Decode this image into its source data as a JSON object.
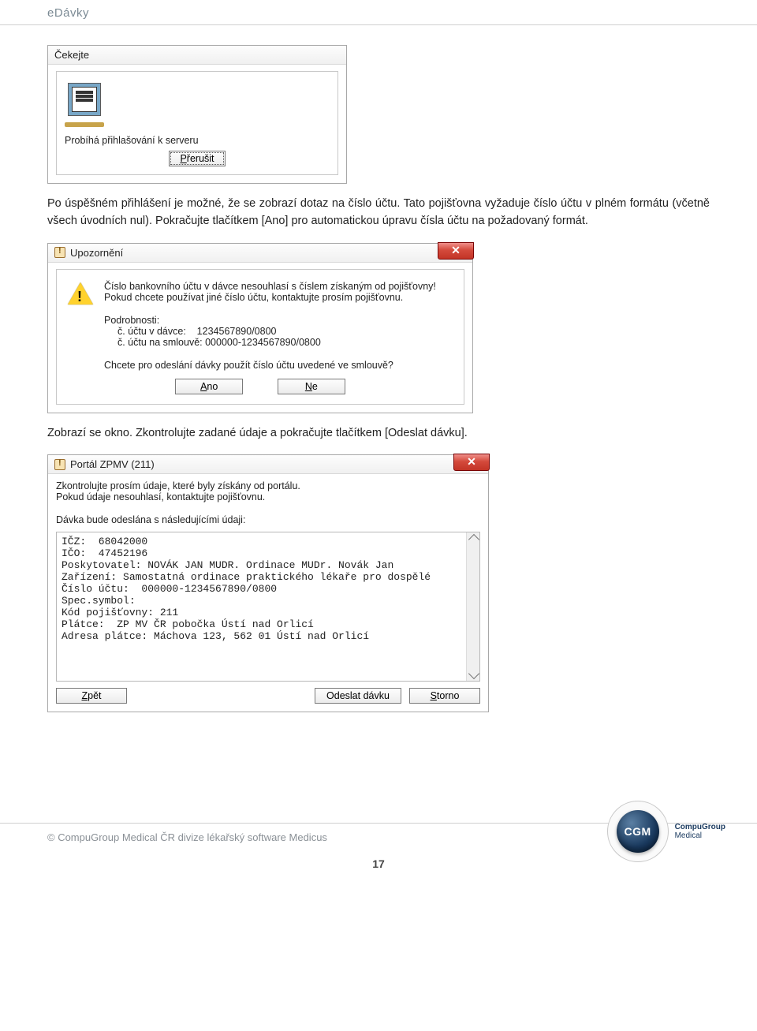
{
  "doc": {
    "header": "eDávky",
    "para1": "Po úspěšném přihlášení je možné, že se zobrazí dotaz na číslo účtu. Tato pojišťovna vyžaduje číslo účtu v plném formátu (včetně všech úvodních nul). Pokračujte tlačítkem [Ano] pro automatickou úpravu čísla účtu na požadovaný formát.",
    "para2": "Zobrazí se okno. Zkontrolujte zadané údaje a pokračujte tlačítkem [Odeslat dávku].",
    "footer": "© CompuGroup Medical ČR divize lékařský software Medicus",
    "page_number": "17"
  },
  "wait_dialog": {
    "title": "Čekejte",
    "status": "Probíhá přihlašování k serveru",
    "cancel_label": "Přerušit"
  },
  "warn_dialog": {
    "title": "Upozornění",
    "line1": "Číslo bankovního účtu v dávce nesouhlasí s číslem získaným od pojišťovny!",
    "line2": "Pokud chcete používat jiné číslo účtu, kontaktujte prosím pojišťovnu.",
    "line3": "Podrobnosti:",
    "line4": "  č. účtu v dávce:    1234567890/0800",
    "line5": "  č. účtu na smlouvě: 000000-1234567890/0800",
    "line6": "Chcete pro odeslání dávky použít číslo účtu uvedené ve smlouvě?",
    "yes_label": "Ano",
    "no_label": "Ne"
  },
  "portal_dialog": {
    "title": "Portál ZPMV (211)",
    "intro1": "Zkontrolujte prosím údaje, které byly získány od portálu.",
    "intro2": "Pokud údaje nesouhlasí, kontaktujte pojišťovnu.",
    "intro3": "Dávka bude odeslána s následujícími údaji:",
    "details": "IČZ:  68042000\nIČO:  47452196\nPoskytovatel: NOVÁK JAN MUDR. Ordinace MUDr. Novák Jan\nZařízení: Samostatná ordinace praktického lékaře pro dospělé\nČíslo účtu:  000000-1234567890/0800\nSpec.symbol:\nKód pojišťovny: 211\nPlátce:  ZP MV ČR pobočka Ústí nad Orlicí\nAdresa plátce: Máchova 123, 562 01 Ústí nad Orlicí",
    "back_label": "Zpět",
    "send_label": "Odeslat dávku",
    "storno_label": "Storno"
  },
  "logo": {
    "abbr": "CGM",
    "full1": "CompuGroup",
    "full2": "Medical"
  }
}
